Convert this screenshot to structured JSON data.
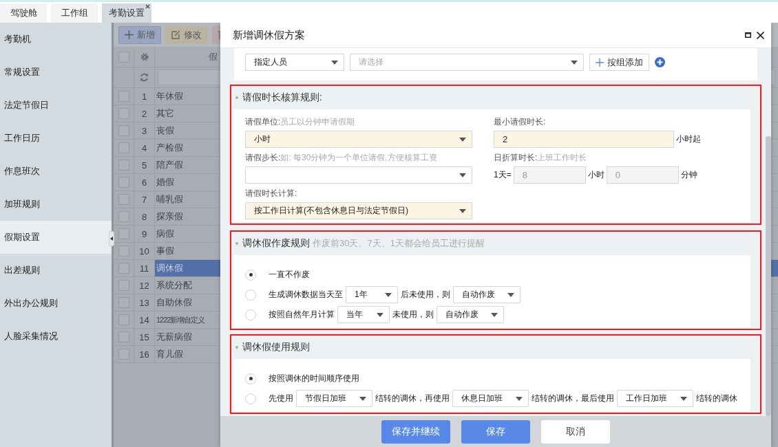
{
  "tabs": [
    {
      "label": "驾驶舱",
      "selected": false,
      "closable": false
    },
    {
      "label": "工作组",
      "selected": false,
      "closable": false
    },
    {
      "label": "考勤设置",
      "selected": true,
      "closable": true
    }
  ],
  "sidebar": {
    "items": [
      {
        "label": "考勤机",
        "selected": false
      },
      {
        "label": "常规设置",
        "selected": false
      },
      {
        "label": "法定节假日",
        "selected": false
      },
      {
        "label": "工作日历",
        "selected": false
      },
      {
        "label": "作息班次",
        "selected": false
      },
      {
        "label": "加班规则",
        "selected": false
      },
      {
        "label": "假期设置",
        "selected": true
      },
      {
        "label": "出差规则",
        "selected": false
      },
      {
        "label": "外出办公规则",
        "selected": false
      },
      {
        "label": "人脸采集情况",
        "selected": false
      }
    ]
  },
  "toolbar": [
    {
      "kind": "add",
      "label": "新增"
    },
    {
      "kind": "edit",
      "label": "修改"
    },
    {
      "kind": "delete"
    }
  ],
  "table": {
    "columns": [
      "假"
    ],
    "all_checked": false,
    "rows": [
      {
        "number": "1",
        "name": "年休假",
        "selected": false,
        "checked": false
      },
      {
        "number": "2",
        "name": "其它",
        "selected": false,
        "checked": false
      },
      {
        "number": "3",
        "name": "丧假",
        "selected": false,
        "checked": false
      },
      {
        "number": "4",
        "name": "产检假",
        "selected": false,
        "checked": false
      },
      {
        "number": "5",
        "name": "陪产假",
        "selected": false,
        "checked": false
      },
      {
        "number": "6",
        "name": "婚假",
        "selected": false,
        "checked": false
      },
      {
        "number": "7",
        "name": "哺乳假",
        "selected": false,
        "checked": false
      },
      {
        "number": "8",
        "name": "探亲假",
        "selected": false,
        "checked": false
      },
      {
        "number": "9",
        "name": "病假",
        "selected": false,
        "checked": false
      },
      {
        "number": "10",
        "name": "事假",
        "selected": false,
        "checked": false
      },
      {
        "number": "11",
        "name": "调休假",
        "selected": true,
        "checked": false
      },
      {
        "number": "12",
        "name": "系统分配",
        "selected": false,
        "checked": false
      },
      {
        "number": "13",
        "name": "自助休假",
        "selected": false,
        "checked": false
      },
      {
        "number": "14",
        "name": "1222新增自定义",
        "selected": false,
        "checked": false
      },
      {
        "number": "15",
        "name": "无薪病假",
        "selected": false,
        "checked": false
      },
      {
        "number": "16",
        "name": "育儿假",
        "selected": false,
        "checked": false
      }
    ]
  },
  "dialog": {
    "title": "新增调休假方案",
    "assign": {
      "scope": "指定人员",
      "placeholder": "请选择",
      "group_button": "按组添加"
    },
    "duration_rules": {
      "title": "请假时长核算规则:",
      "highlighted": true,
      "unit": {
        "label": "请假单位:",
        "hint": "员工以分钟申请假期",
        "value": "小时",
        "highlighted": true
      },
      "minimum": {
        "label": "最小请假时长:",
        "value": "2",
        "suffix": "小时起",
        "highlighted": true
      },
      "step": {
        "label": "请假步长:",
        "hint": "如: 每30分钟为一个单位请假,方便核算工资",
        "highlighted": false
      },
      "day_conversion": {
        "label": "日折算时长:",
        "hint": "上班工作时长",
        "prefix": "1天=",
        "hours": "8",
        "hours_unit": "小时",
        "minutes": "0",
        "minutes_unit": "分钟",
        "disabled": true
      },
      "calculation": {
        "label": "请假时长计算:",
        "value": "按工作日计算(不包含休息日与法定节假日)",
        "highlighted": true
      }
    },
    "expiry_rules": {
      "title": "调休假作废规则",
      "hint": "作废前30天、7天、1天都会给员工进行提醒",
      "highlighted": true,
      "options": [
        {
          "selected": true,
          "parts": [
            {
              "kind": "text",
              "text": "一直不作废"
            }
          ]
        },
        {
          "selected": false,
          "parts": [
            {
              "kind": "text",
              "text": "生成调休数据当天至"
            },
            {
              "kind": "select",
              "text": "1年"
            },
            {
              "kind": "text",
              "text": "后未使用，则"
            },
            {
              "kind": "select",
              "text": "自动作废"
            }
          ]
        },
        {
          "selected": false,
          "parts": [
            {
              "kind": "text",
              "text": "按照自然年月计算"
            },
            {
              "kind": "select",
              "text": "当年"
            },
            {
              "kind": "text",
              "text": "未使用，则"
            },
            {
              "kind": "select",
              "text": "自动作废"
            }
          ]
        }
      ]
    },
    "usage_rules": {
      "title": "调休假使用规则",
      "highlighted": true,
      "options": [
        {
          "selected": true,
          "parts": [
            {
              "kind": "text",
              "text": "按照调休的时间顺序使用"
            }
          ]
        },
        {
          "selected": false,
          "parts": [
            {
              "kind": "text",
              "text": "先使用"
            },
            {
              "kind": "select",
              "text": "节假日加班"
            },
            {
              "kind": "text",
              "text": "结转的调休，再使用"
            },
            {
              "kind": "select",
              "text": "休息日加班"
            },
            {
              "kind": "text",
              "text": "结转的调休，最后使用"
            },
            {
              "kind": "select",
              "text": "工作日加班"
            },
            {
              "kind": "text",
              "text": "结转的调休"
            }
          ]
        }
      ]
    },
    "buttons": [
      {
        "kind": "primary",
        "label": "保存并继续"
      },
      {
        "kind": "primary",
        "label": "保存"
      },
      {
        "kind": "default",
        "label": "取消"
      }
    ]
  }
}
